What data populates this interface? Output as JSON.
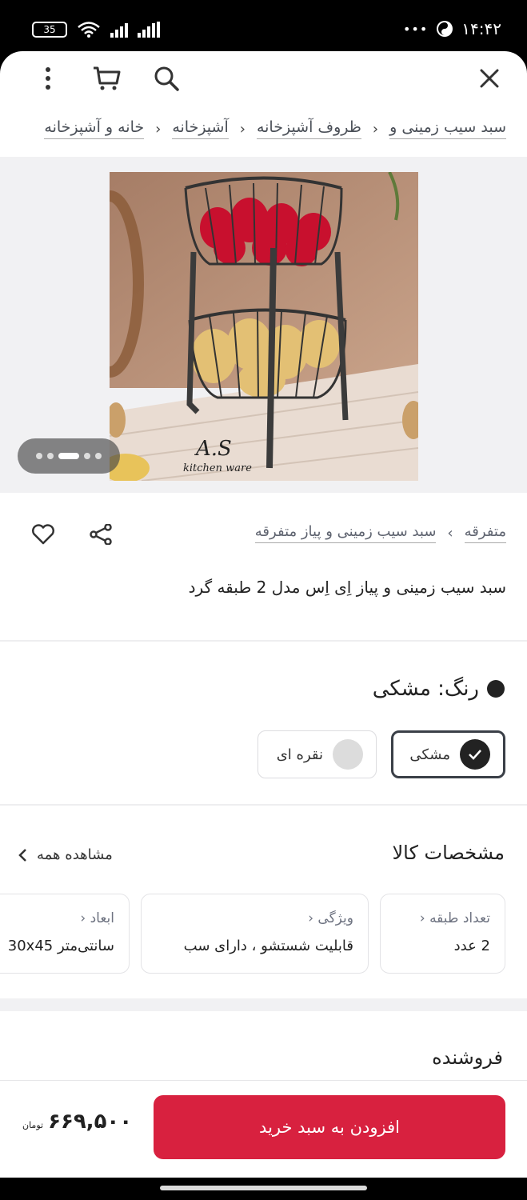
{
  "status_bar": {
    "time": "۱۴:۴۲",
    "battery": "35",
    "more": "•••"
  },
  "breadcrumbs": [
    {
      "label": "خانه و آشپزخانه"
    },
    {
      "label": "آشپزخانه"
    },
    {
      "label": "ظروف آشپزخانه"
    },
    {
      "label": "سبد سیب زمینی و"
    }
  ],
  "gallery": {
    "watermark_main": "A.S",
    "watermark_sub": "kitchen ware",
    "slide_count": 5,
    "active_slide": 3
  },
  "product": {
    "category_path": [
      {
        "label": "متفرقه"
      },
      {
        "label": "سبد سیب زمینی و پیاز متفرقه"
      }
    ],
    "title": "سبد سیب زمینی و پیاز اِی اِس مدل 2 طبقه گرد"
  },
  "color": {
    "heading": "رنگ: مشکی",
    "options": [
      {
        "label": "مشکی",
        "swatch": "#222222",
        "selected": true
      },
      {
        "label": "نقره ای",
        "swatch": "#dcdcdc",
        "selected": false
      }
    ]
  },
  "specs": {
    "heading": "مشخصات کالا",
    "view_all": "مشاهده همه",
    "items": [
      {
        "label": "تعداد طبقه",
        "value": "2 عدد"
      },
      {
        "label": "ویژگی",
        "value": "قابلیت شستشو ، دارای سب"
      },
      {
        "label": "ابعاد",
        "value": "سانتی‌متر 30x45"
      }
    ]
  },
  "seller": {
    "heading": "فروشنده"
  },
  "purchase": {
    "add_to_cart": "افزودن به سبد خرید",
    "price": "۶۶۹,۵۰۰",
    "currency": "تومان"
  },
  "colors": {
    "accent": "#d8213f",
    "selected_border": "#3a3f47"
  }
}
